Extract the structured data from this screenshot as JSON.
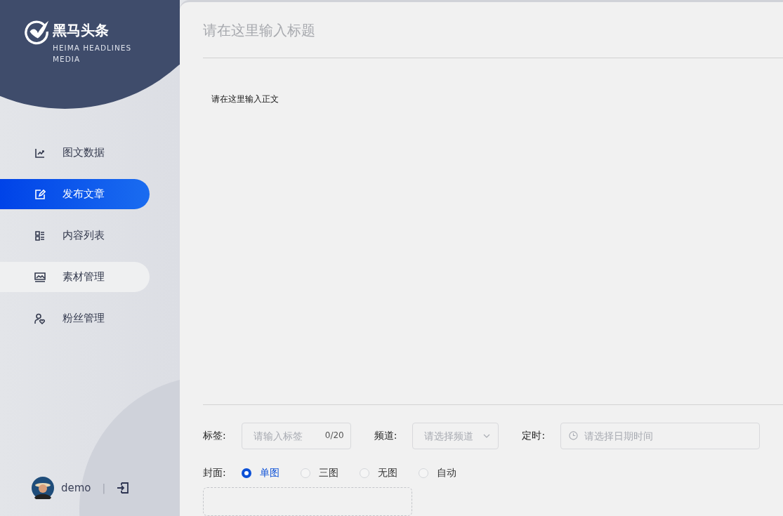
{
  "brand": {
    "name": "黑马头条",
    "subtitle": "HEIMA HEADLINES MEDIA"
  },
  "nav": [
    {
      "label": "图文数据",
      "kind": "chart",
      "selected": false,
      "hovered": false
    },
    {
      "label": "发布文章",
      "kind": "edit",
      "selected": true,
      "hovered": false
    },
    {
      "label": "内容列表",
      "kind": "list",
      "selected": false,
      "hovered": false
    },
    {
      "label": "素材管理",
      "kind": "image",
      "selected": false,
      "hovered": true
    },
    {
      "label": "粉丝管理",
      "kind": "user",
      "selected": false,
      "hovered": false
    }
  ],
  "user": {
    "name": "demo",
    "separator": "|"
  },
  "editor": {
    "title": {
      "placeholder": "请在这里输入标题"
    },
    "body": {
      "placeholder": "请在这里输入正文"
    }
  },
  "form": {
    "tag": {
      "label": "标签:",
      "placeholder": "请输入标签",
      "counter": "0/20"
    },
    "channel": {
      "label": "频道:",
      "placeholder": "请选择频道"
    },
    "schedule": {
      "label": "定时:",
      "placeholder": "请选择日期时间"
    },
    "cover": {
      "label": "封面:",
      "options": [
        {
          "label": "单图",
          "selected": true
        },
        {
          "label": "三图",
          "selected": false
        },
        {
          "label": "无图",
          "selected": false
        },
        {
          "label": "自动",
          "selected": false
        }
      ]
    }
  }
}
